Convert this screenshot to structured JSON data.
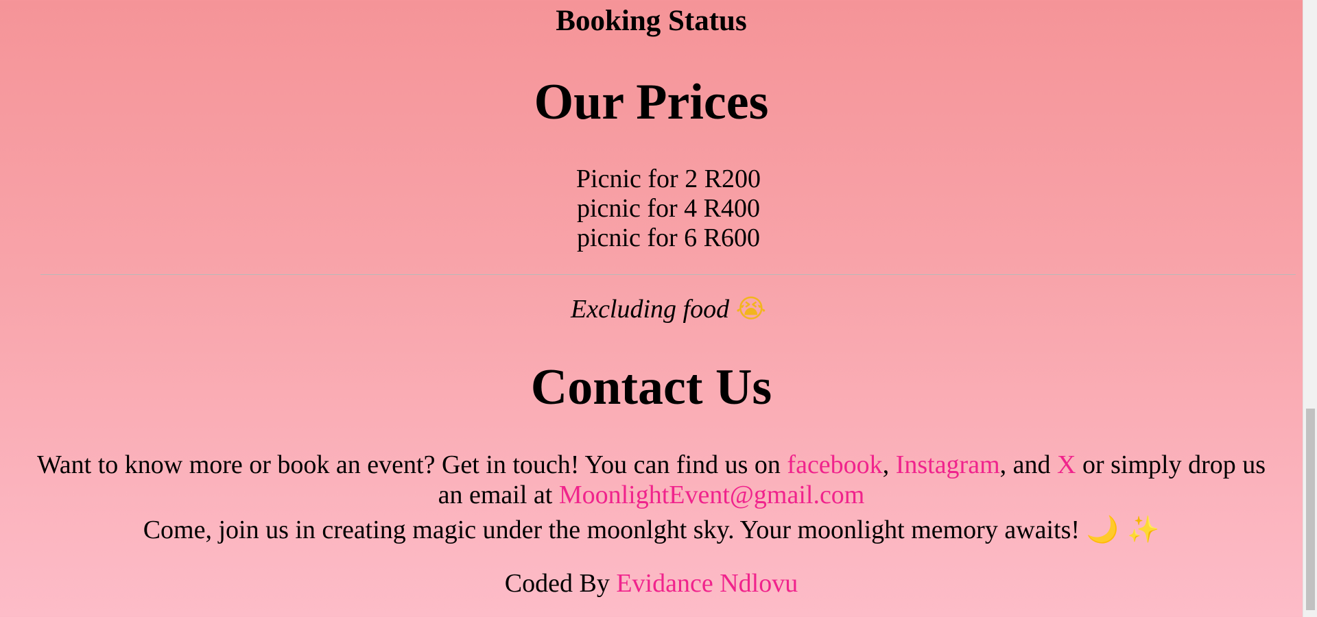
{
  "booking_status": "Booking Status",
  "prices": {
    "heading": "Our Prices",
    "items": [
      "Picnic for 2 R200",
      "picnic for 4 R400",
      "picnic for 6 R600"
    ],
    "note": "Excluding food",
    "note_emoji": "😭"
  },
  "contact": {
    "heading": "Contact Us",
    "intro": "Want to know more or book an event? Get in touch! You can find us on ",
    "facebook_label": "facebook",
    "sep_1": ", ",
    "instagram_label": "Instagram",
    "sep_2": ", and ",
    "x_label": "X",
    "outro": " or simply drop us an email at ",
    "email": "MoonlightEvent@gmail.com",
    "tagline": "Come, join us in creating magic under the moonlght sky. Your moonlight memory awaits! ",
    "tagline_emoji": "🌙 ✨"
  },
  "footer": {
    "credit_prefix": "Coded By ",
    "author": "Evidance Ndlovu"
  },
  "colors": {
    "link": "#f0238c",
    "background_top": "#f59498",
    "background_bottom": "#fdbcc8"
  }
}
